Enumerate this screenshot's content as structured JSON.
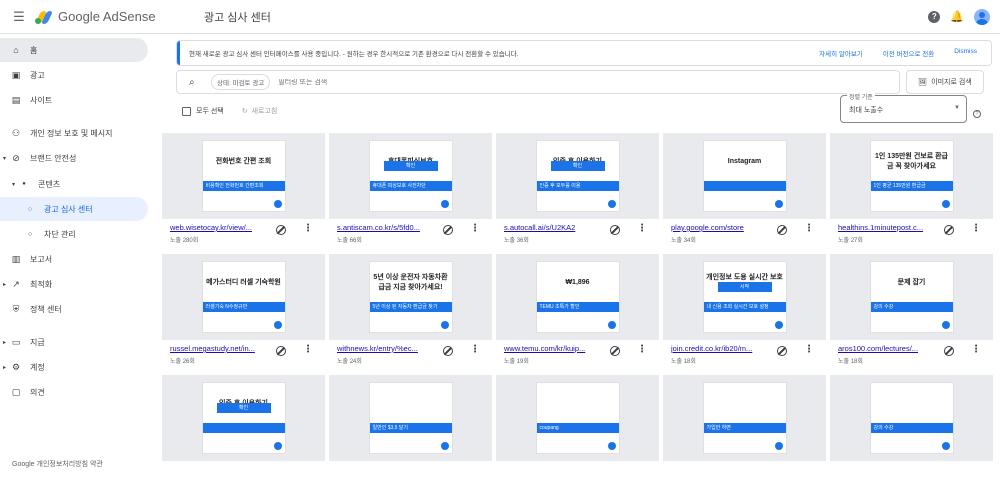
{
  "app": {
    "name": "Google AdSense",
    "page_title": "광고 심사 센터"
  },
  "sidebar": {
    "items": [
      {
        "label": "홈",
        "icon": "home-icon"
      },
      {
        "label": "광고",
        "icon": "ads-icon"
      },
      {
        "label": "사이트",
        "icon": "sites-icon"
      },
      {
        "label": "개인 정보 보호 및 메시지",
        "icon": "privacy-icon"
      },
      {
        "label": "브랜드 안전성",
        "icon": "block-icon"
      },
      {
        "label": "콘텐츠",
        "icon": "dot-icon"
      },
      {
        "label": "광고 심사 센터",
        "icon": "circle-icon"
      },
      {
        "label": "차단 관리",
        "icon": "circle-icon"
      },
      {
        "label": "보고서",
        "icon": "reports-icon"
      },
      {
        "label": "최적화",
        "icon": "trend-icon"
      },
      {
        "label": "정책 센터",
        "icon": "shield-icon"
      },
      {
        "label": "지급",
        "icon": "payments-icon"
      },
      {
        "label": "계정",
        "icon": "gear-icon"
      },
      {
        "label": "의견",
        "icon": "feedback-icon"
      }
    ],
    "footer": "Google  개인정보처리방침  약관"
  },
  "banner": {
    "message": "현재 새로운 광고 심사 센터 인터페이스를 사용 중입니다. - 원하는 경우 한시적으로 기존 환경으로 다시 전환할 수 있습니다.",
    "learn_more": "자세히 알아보기",
    "switch_back": "이전 버전으로 전환",
    "dismiss": "Dismiss"
  },
  "search": {
    "chip": "상태: 미검토 광고",
    "placeholder": "필터링 또는 검색"
  },
  "image_search": "이미지로 검색",
  "toolbar": {
    "select_all": "모두 선택",
    "refresh": "새로고침"
  },
  "sort": {
    "label": "정렬 기준",
    "value": "최대 노출수"
  },
  "cards": [
    {
      "url": "web.wisetocay.kr/view/...",
      "impressions": "노출 280회",
      "ad_title": "전화번호 간편 조회",
      "ad_sub": "비용확인 전화번호 간편조회",
      "ad_btn": ""
    },
    {
      "url": "s.antiscam.co.kr/s/5fd0...",
      "impressions": "노출 66회",
      "ad_title": "휴대폰피싱보호",
      "ad_sub": "휴대폰 피싱보호 사전차단",
      "ad_btn": "확인"
    },
    {
      "url": "s.autocall.ai/s/U2KA2",
      "impressions": "노출 36회",
      "ad_title": "인증 후 이용하기",
      "ad_sub": "인증 후 모두를 이용",
      "ad_btn": "확인"
    },
    {
      "url": "play.google.com/store",
      "impressions": "노출 34회",
      "ad_title": "Instagram",
      "ad_sub": "",
      "ad_btn": ""
    },
    {
      "url": "healthins.1minutepost.c...",
      "impressions": "노출 27회",
      "ad_title": "1인 135만원 건보료 환급금 꼭 찾아가세요",
      "ad_sub": "1인 평균 135만원 환급금",
      "ad_btn": ""
    },
    {
      "url": "russel.megastudy.net/in...",
      "impressions": "노출 26회",
      "ad_title": "메가스터디 러셀 기숙학원",
      "ad_sub": "러셀기숙 N수정규반",
      "ad_btn": ""
    },
    {
      "url": "withnews.kr/entry/%ec...",
      "impressions": "노출 24회",
      "ad_title": "5년 이상 운전자 자동차환급금 지금 찾아가세요!",
      "ad_sub": "5년 이상 된 자동차 환급금 찾기",
      "ad_btn": ""
    },
    {
      "url": "www.temu.com/kr/kuip...",
      "impressions": "노출 19회",
      "ad_title": "₩1,896",
      "ad_sub": "TEMU 초특가 할인",
      "ad_btn": ""
    },
    {
      "url": "join.credit.co.kr/ib20/m...",
      "impressions": "노출 18회",
      "ad_title": "개인정보 도용 실시간 보호하기",
      "ad_sub": "내 신용 조회 실시간 보호 설정",
      "ad_btn": "시작"
    },
    {
      "url": "aros100.com/lectures/...",
      "impressions": "노출 18회",
      "ad_title": "문제 잡기",
      "ad_sub": "강의 수강",
      "ad_btn": ""
    },
    {
      "url": "",
      "impressions": "",
      "ad_title": "인증 후 이용하기",
      "ad_sub": "",
      "ad_btn": "확인"
    },
    {
      "url": "",
      "impressions": "",
      "ad_title": "",
      "ad_sub": "일반인 $3.5 달기",
      "ad_btn": ""
    },
    {
      "url": "",
      "impressions": "",
      "ad_title": "",
      "ad_sub": "coupang",
      "ad_btn": ""
    },
    {
      "url": "",
      "impressions": "",
      "ad_title": "",
      "ad_sub": "가입만 하면",
      "ad_btn": ""
    },
    {
      "url": "",
      "impressions": "",
      "ad_title": "",
      "ad_sub": "강의 수강",
      "ad_btn": ""
    }
  ]
}
